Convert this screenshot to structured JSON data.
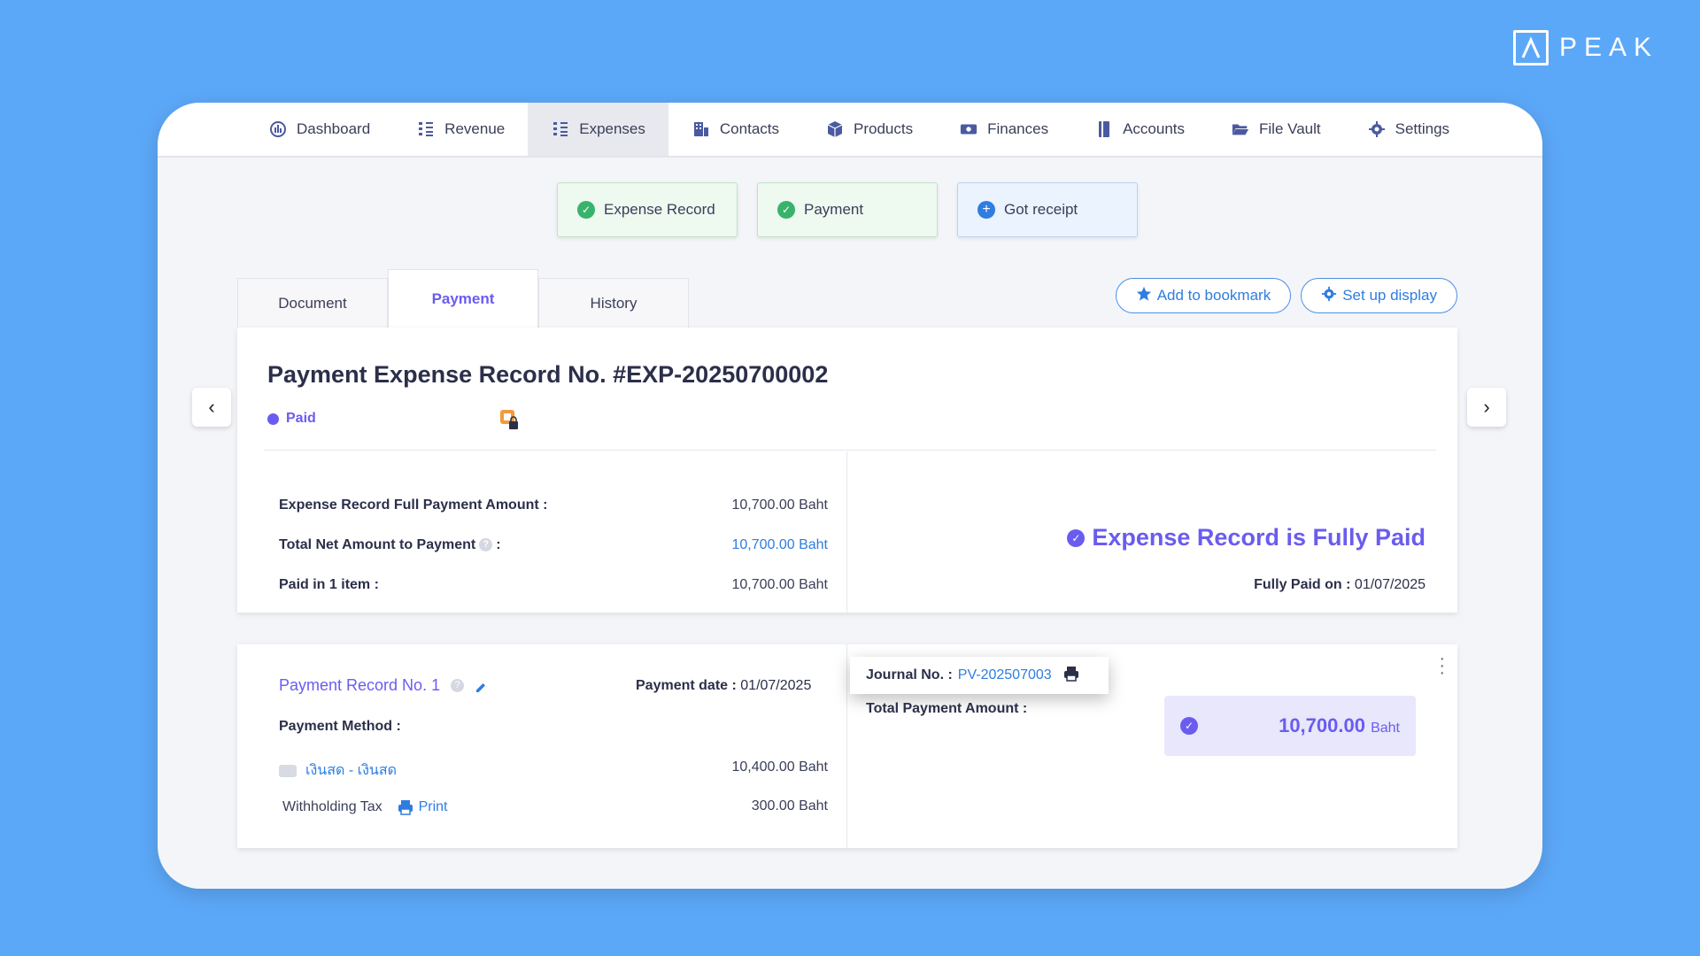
{
  "logo": {
    "text": "PEAK"
  },
  "nav": [
    {
      "label": "Dashboard",
      "icon": "dashboard-icon"
    },
    {
      "label": "Revenue",
      "icon": "revenue-icon"
    },
    {
      "label": "Expenses",
      "icon": "expenses-icon"
    },
    {
      "label": "Contacts",
      "icon": "contacts-icon"
    },
    {
      "label": "Products",
      "icon": "products-icon"
    },
    {
      "label": "Finances",
      "icon": "finances-icon"
    },
    {
      "label": "Accounts",
      "icon": "accounts-icon"
    },
    {
      "label": "File Vault",
      "icon": "folder-icon"
    },
    {
      "label": "Settings",
      "icon": "gear-icon"
    }
  ],
  "steps": {
    "expense_record": "Expense Record",
    "payment": "Payment",
    "got_receipt": "Got receipt"
  },
  "tabs": {
    "document": "Document",
    "payment": "Payment",
    "history": "History"
  },
  "actions": {
    "bookmark": "Add to bookmark",
    "setup_display": "Set up display"
  },
  "summary": {
    "title": "Payment Expense Record No. #EXP-20250700002",
    "status": "Paid",
    "full_payment_label": "Expense Record Full Payment Amount :",
    "full_payment_value": "10,700.00 Baht",
    "net_amount_label": "Total Net Amount to Payment",
    "net_amount_colon": ":",
    "net_amount_value": "10,700.00 Baht",
    "paid_items_label": "Paid in 1 item :",
    "paid_items_value": "10,700.00 Baht",
    "fully_paid_text": "Expense Record is Fully Paid",
    "paid_on_label": "Fully Paid on :",
    "paid_on_value": "01/07/2025"
  },
  "payment_record": {
    "title": "Payment Record No. 1",
    "date_label": "Payment date :",
    "date_value": "01/07/2025",
    "method_label": "Payment Method :",
    "method_name": "เงินสด - เงินสด",
    "method_amount": "10,400.00 Baht",
    "wht_label": "Withholding Tax",
    "print_label": "Print",
    "wht_amount": "300.00 Baht",
    "journal_label": "Journal No. :",
    "journal_value": "PV-202507003",
    "total_label": "Total Payment Amount :",
    "total_value": "10,700.00",
    "total_unit": "Baht"
  },
  "colors": {
    "accent": "#6a5cf0",
    "link": "#2f7de0",
    "background": "#5ca8f8",
    "success": "#39b36b"
  }
}
